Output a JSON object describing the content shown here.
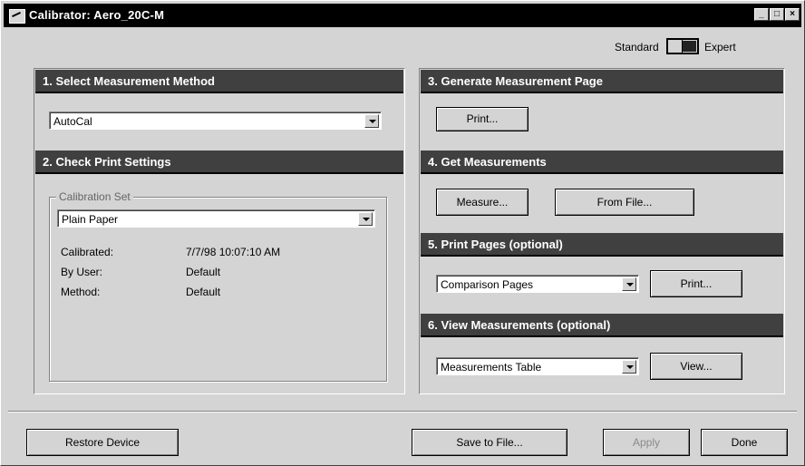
{
  "window": {
    "title": "Calibrator: Aero_20C-M"
  },
  "mode": {
    "standard_label": "Standard",
    "expert_label": "Expert",
    "selected": "Expert"
  },
  "section1": {
    "header": "1. Select Measurement Method",
    "method_value": "AutoCal"
  },
  "section2": {
    "header": "2. Check Print Settings",
    "group_label": "Calibration Set",
    "set_value": "Plain Paper",
    "rows": [
      {
        "label": "Calibrated:",
        "value": "7/7/98 10:07:10 AM"
      },
      {
        "label": "By User:",
        "value": "Default"
      },
      {
        "label": "Method:",
        "value": "Default"
      }
    ]
  },
  "section3": {
    "header": "3. Generate Measurement Page",
    "print_label": "Print..."
  },
  "section4": {
    "header": "4. Get Measurements",
    "measure_label": "Measure...",
    "fromfile_label": "From File..."
  },
  "section5": {
    "header": "5. Print Pages (optional)",
    "pages_value": "Comparison Pages",
    "print_label": "Print..."
  },
  "section6": {
    "header": "6. View Measurements (optional)",
    "view_value": "Measurements Table",
    "view_label": "View..."
  },
  "footer": {
    "restore_label": "Restore Device",
    "save_label": "Save to File...",
    "apply_label": "Apply",
    "done_label": "Done"
  }
}
